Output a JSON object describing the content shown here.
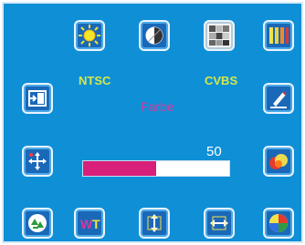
{
  "osd": {
    "signal_standard": "NTSC",
    "input_source": "CVBS",
    "selected_item": "Farbe",
    "value": 50,
    "fraction": 0.5
  },
  "icons": {
    "top": [
      "brightness-icon",
      "contrast-icon",
      "pattern-icon",
      "color-bars-icon"
    ],
    "left": [
      "exit-input-icon",
      "position-icon",
      "recycle-icon"
    ],
    "right": [
      "edit-icon",
      "color-icon",
      "color-wheel-icon"
    ],
    "bottom": [
      "text-icon",
      "vertical-size-icon",
      "horizontal-size-icon"
    ]
  }
}
